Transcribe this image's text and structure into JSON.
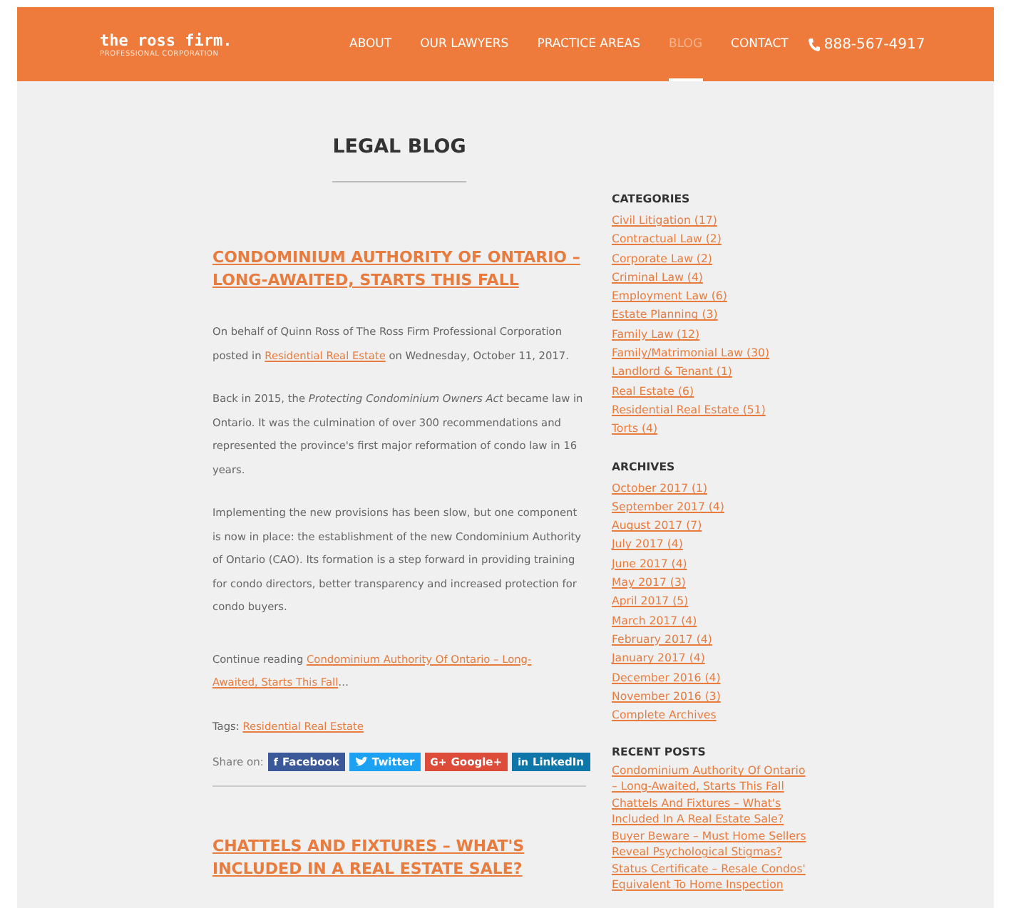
{
  "header": {
    "logo": "the ross firm.",
    "logo_subtitle": "PROFESSIONAL CORPORATION",
    "nav": [
      {
        "label": "ABOUT",
        "selected": false
      },
      {
        "label": "OUR LAWYERS",
        "selected": false
      },
      {
        "label": "PRACTICE AREAS",
        "selected": false
      },
      {
        "label": "BLOG",
        "selected": true
      },
      {
        "label": "CONTACT",
        "selected": false
      }
    ],
    "phone": "888-567-4917"
  },
  "page_title": "LEGAL BLOG",
  "posts": [
    {
      "title": "CONDOMINIUM AUTHORITY OF ONTARIO – LONG-AWAITED, STARTS THIS FALL",
      "byline": {
        "before": "On behalf of Quinn Ross of The Ross Firm Professional Corporation posted in",
        "link": "Residential Real Estate",
        "after": "on Wednesday, October 11, 2017."
      },
      "paragraphs": [
        "Back in 2015, the *Protecting Condominium Owners Act* became law in Ontario. It was the culmination of over 300 recommendations and represented the province's first major reformation of condo law in 16 years.",
        "Implementing the new provisions has been slow, but one component is now in place: the establishment of the new Condominium Authority of Ontario (CAO). Its formation is a step forward in providing training for condo directors, better transparency and increased protection for condo buyers."
      ],
      "continue": {
        "before": "Continue reading",
        "link": [
          "Condominium Authority Of Ontario – Long-",
          "Awaited, Starts This Fall"
        ],
        "after": "…"
      },
      "tags": {
        "label": "Tags:",
        "link": "Residential Real Estate"
      },
      "share": {
        "label": "Share on:",
        "buttons": [
          {
            "kind": "facebook",
            "icon": "f",
            "label": "Facebook"
          },
          {
            "kind": "twitter",
            "label": "Twitter"
          },
          {
            "kind": "google",
            "icon": "G+",
            "label": "Google+"
          },
          {
            "kind": "linkedin",
            "icon": "in",
            "label": "LinkedIn"
          }
        ]
      }
    },
    {
      "title": "CHATTELS AND FIXTURES – WHAT'S INCLUDED IN A REAL ESTATE SALE?"
    }
  ],
  "sidebar": [
    {
      "heading": "CATEGORIES",
      "items": [
        "Civil Litigation (17)",
        "Contractual Law (2)",
        "Corporate Law (2)",
        "Criminal Law (4)",
        "Employment Law (6)",
        "Estate Planning (3)",
        "Family Law (12)",
        "Family/Matrimonial Law (30)",
        "Landlord & Tenant (1)",
        "Real Estate (6)",
        "Residential Real Estate (51)",
        "Torts (4)"
      ]
    },
    {
      "heading": "ARCHIVES",
      "items": [
        "October 2017 (1)",
        "September 2017 (4)",
        "August 2017 (7)",
        "July 2017 (4)",
        "June 2017 (4)",
        "May 2017 (3)",
        "April 2017 (5)",
        "March 2017 (4)",
        "February 2017 (4)",
        "January 2017 (4)",
        "December 2016 (4)",
        "November 2016 (3)",
        "Complete Archives"
      ]
    },
    {
      "heading": "RECENT POSTS",
      "items": [
        "Condominium Authority Of Ontario – Long-Awaited, Starts This Fall",
        "Chattels And Fixtures – What's Included In A Real Estate Sale?",
        "Buyer Beware – Must Home Sellers Reveal Psychological Stigmas?",
        "Status Certificate – Resale Condos' Equivalent To Home Inspection"
      ]
    }
  ]
}
